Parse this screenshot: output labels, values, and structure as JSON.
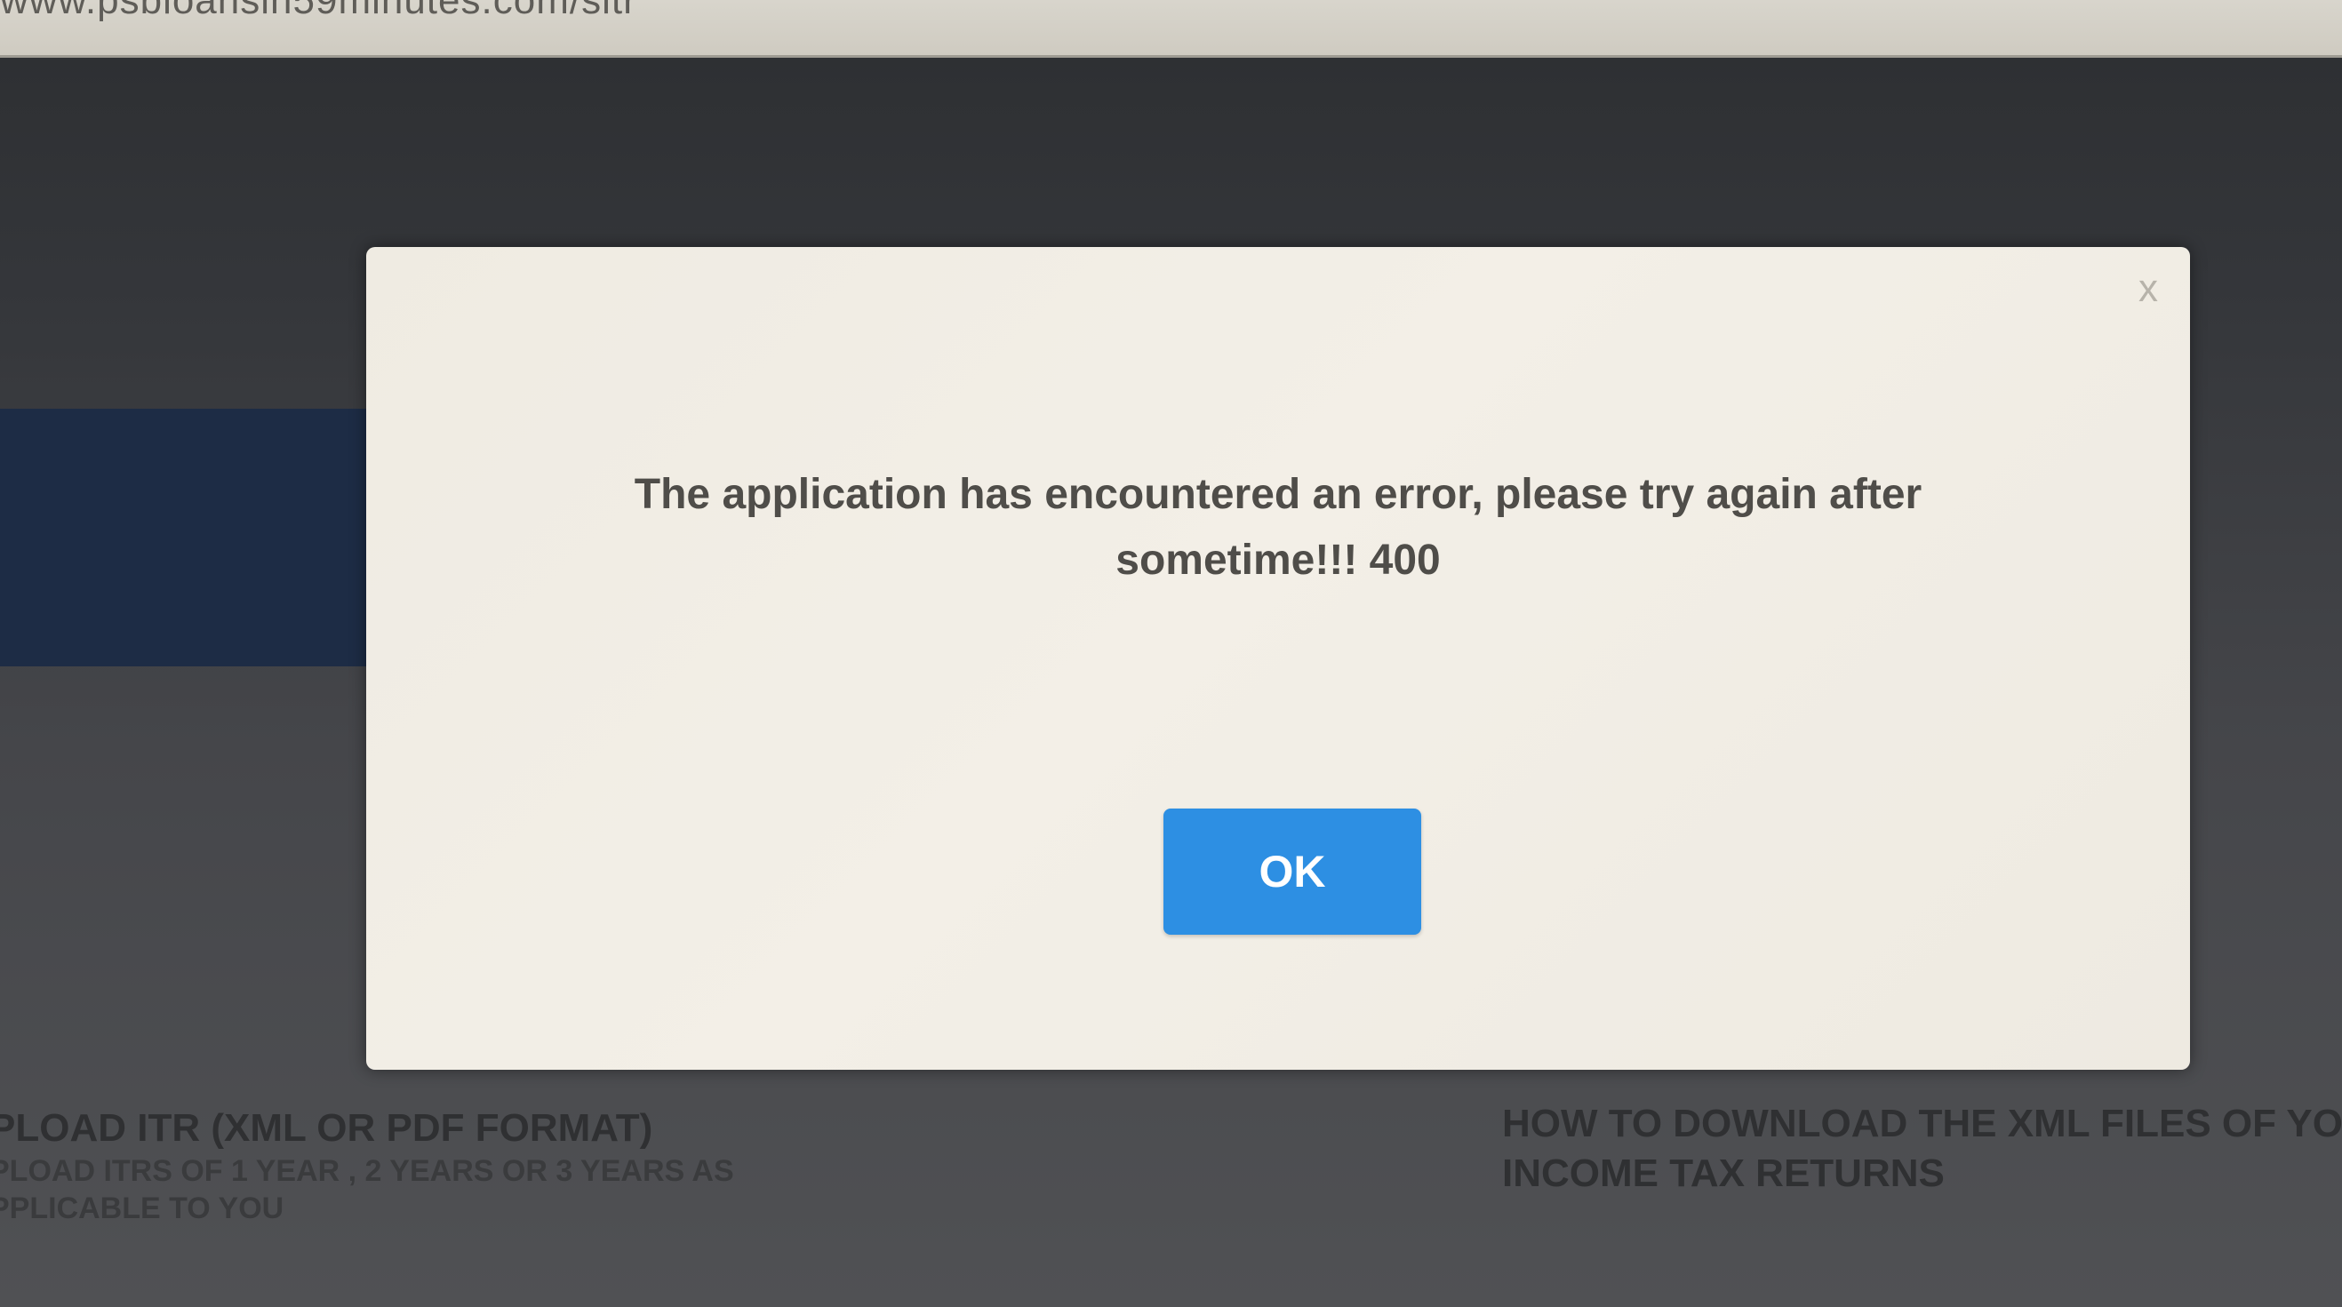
{
  "browser": {
    "url": "www.psbloansin59minutes.com/sitr"
  },
  "background_page": {
    "left_section_title": "PLOAD ITR (XML OR PDF FORMAT)",
    "left_section_subtitle": "PLOAD ITRS OF 1 YEAR , 2 YEARS OR 3 YEARS AS PPLICABLE TO YOU",
    "right_section_title_line1": "HOW TO DOWNLOAD THE XML FILES OF YO",
    "right_section_title_line2": "INCOME TAX RETURNS"
  },
  "modal": {
    "close_label": "x",
    "message": "The application has encountered an error, please try again after sometime!!! 400",
    "ok_label": "OK"
  },
  "colors": {
    "ok_button": "#2d8fe3",
    "modal_background": "#f1ede5",
    "overlay": "#3e3f42"
  }
}
